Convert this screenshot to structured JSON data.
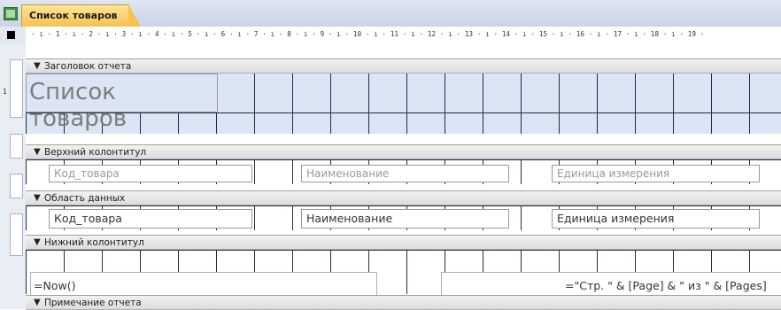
{
  "tab": {
    "label": "Список товаров"
  },
  "ruler": {
    "text": "· ı · 1 · ı · 2 · ı · 3 · ı · 4 · ı · 5 · ı · 6 · ı · 7 · ı · 8 · ı · 9 · ı · 10 · ı · 11 · ı · 12 · ı · 13 · ı · 14 · ı · 15 · ı · 16 · ı · 17 · ı · 18 · ı · 19 ·"
  },
  "vruler": {
    "mark": "1"
  },
  "sections": {
    "report_header": {
      "title": "Заголовок отчета"
    },
    "page_header": {
      "title": "Верхний колонтитул"
    },
    "detail": {
      "title": "Область данных"
    },
    "page_footer": {
      "title": "Нижний колонтитул"
    },
    "report_footer": {
      "title": "Примечание отчета"
    }
  },
  "report_header": {
    "title": "Список товаров"
  },
  "page_header": {
    "labels": [
      "Код_товара",
      "Наименование",
      "Единица измерения"
    ]
  },
  "detail": {
    "fields": [
      "Код_товара",
      "Наименование",
      "Единица измерения"
    ]
  },
  "page_footer": {
    "now": "=Now()",
    "pages": "=\"Стр. \" & [Page] & \" из \" & [Pages]"
  }
}
